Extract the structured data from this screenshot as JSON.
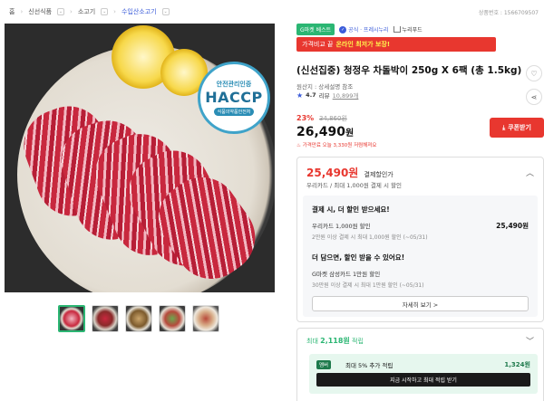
{
  "breadcrumb": {
    "home": "홈",
    "items": [
      "신선식품",
      "소고기",
      "수입산소고기"
    ]
  },
  "product_no": "상품번호 : 1566709507",
  "badge_haccp": {
    "top": "안전관리인증",
    "main": "HACCP",
    "bottom": "식품의약품안전처"
  },
  "tags": {
    "best": "G마켓 베스트",
    "official": "공식 · 프레시누리",
    "brand": "누리푸드"
  },
  "compare_banner": {
    "label": "가격비교 끝",
    "highlight": "온라인 최저가 보장!"
  },
  "product": {
    "title": "(신선집중) 청정우 차돌박이 250g X 6팩 (총 1.5kg)",
    "origin": "원산지 : 상세설명 참조",
    "rating": "4.7",
    "review_label": "리뷰",
    "review_count": "10,899개",
    "discount_rate": "23%",
    "original_price": "34,860원",
    "price_num": "26,490",
    "price_unit": "원",
    "expire_note": "가격만료 오늘 3,330원 저렴해져요"
  },
  "coupon_button": "쿠폰받기",
  "benefits": {
    "price_num": "25,490원",
    "price_label": "결제할인가",
    "subtitle": "우리카드 / 최대 1,000원 결제 시 할인",
    "section1_heading": "결제 시, 더 할인 받으세요!",
    "card_name": "우리카드 1,000원 할인",
    "card_amount": "25,490원",
    "card_note": "2만원 이상 결제 시 최대 1,000원 할인 (~05/31)",
    "section2_heading": "더 담으면, 할인 받을 수 있어요!",
    "card2_name": "G마켓 삼성카드 1만원 할인",
    "card2_note": "30만원 이상 결제 시 최대 1만원 할인 (~05/31)",
    "more_button": "자세히 보기 >"
  },
  "points": {
    "prefix": "최대",
    "amount": "2,118원",
    "suffix": "적립",
    "tag": "멤버",
    "desc": "최대 5% 추가 적립",
    "value": "1,324원",
    "cta": "지금 시작하고 최대 적립 받기"
  },
  "colors": {
    "accent_red": "#e8372f",
    "accent_green": "#2bb673",
    "link_blue": "#3a5bd9"
  }
}
